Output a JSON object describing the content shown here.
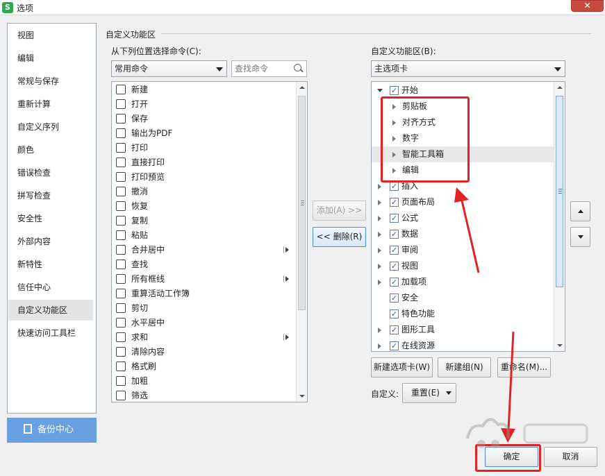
{
  "window": {
    "app_icon": "S",
    "title": "选项",
    "close_glyph": "✕"
  },
  "sidebar": {
    "items": [
      {
        "label": "视图"
      },
      {
        "label": "编辑"
      },
      {
        "label": "常规与保存"
      },
      {
        "label": "重新计算"
      },
      {
        "label": "自定义序列"
      },
      {
        "label": "颜色"
      },
      {
        "label": "错误检查"
      },
      {
        "label": "拼写检查"
      },
      {
        "label": "安全性"
      },
      {
        "label": "外部内容"
      },
      {
        "label": "新特性"
      },
      {
        "label": "信任中心"
      },
      {
        "label": "自定义功能区",
        "active": true
      },
      {
        "label": "快速访问工具栏"
      }
    ],
    "backup_label": "备份中心"
  },
  "main": {
    "group_title": "自定义功能区",
    "left": {
      "label": "从下列位置选择命令(C):",
      "source_value": "常用命令",
      "search_placeholder": "查找命令",
      "commands": [
        {
          "label": "新建",
          "icon": "new-doc-icon"
        },
        {
          "label": "打开",
          "icon": "folder-icon"
        },
        {
          "label": "保存",
          "icon": "save-icon"
        },
        {
          "label": "输出为PDF",
          "icon": "pdf-icon"
        },
        {
          "label": "打印",
          "icon": "printer-icon"
        },
        {
          "label": "直接打印",
          "icon": "print-direct-icon"
        },
        {
          "label": "打印预览",
          "icon": "print-preview-icon"
        },
        {
          "label": "撤消",
          "icon": "undo-icon"
        },
        {
          "label": "恢复",
          "icon": "redo-icon"
        },
        {
          "label": "复制",
          "icon": "copy-icon"
        },
        {
          "label": "粘贴",
          "icon": "paste-icon"
        },
        {
          "label": "合并居中",
          "icon": "merge-center-icon",
          "submenu": true
        },
        {
          "label": "查找",
          "icon": "find-icon"
        },
        {
          "label": "所有框线",
          "icon": "all-borders-icon",
          "submenu": true
        },
        {
          "label": "重算活动工作簿",
          "icon": "recalc-icon"
        },
        {
          "label": "剪切",
          "icon": "scissors-icon"
        },
        {
          "label": "水平居中",
          "icon": "align-center-icon"
        },
        {
          "label": "求和",
          "icon": "sum-icon",
          "submenu": true
        },
        {
          "label": "清除内容",
          "icon": "eraser-icon"
        },
        {
          "label": "格式刷",
          "icon": "format-painter-icon"
        },
        {
          "label": "加粗",
          "icon": "bold-icon"
        },
        {
          "label": "筛选",
          "icon": "filter-icon"
        }
      ]
    },
    "add_label": "添加(A) >>",
    "remove_label": "<< 删除(R)",
    "right": {
      "label": "自定义功能区(B):",
      "scope_value": "主选项卡",
      "tree": [
        {
          "label": "开始",
          "level": 0,
          "checked": true,
          "expanded": true
        },
        {
          "label": "剪贴板",
          "level": 1
        },
        {
          "label": "对齐方式",
          "level": 1
        },
        {
          "label": "数字",
          "level": 1
        },
        {
          "label": "智能工具箱",
          "level": 1,
          "highlight": true
        },
        {
          "label": "编辑",
          "level": 1
        },
        {
          "label": "插入",
          "level": 0,
          "checked": true
        },
        {
          "label": "页面布局",
          "level": 0,
          "checked": true
        },
        {
          "label": "公式",
          "level": 0,
          "checked": true
        },
        {
          "label": "数据",
          "level": 0,
          "checked": true
        },
        {
          "label": "审阅",
          "level": 0,
          "checked": true
        },
        {
          "label": "视图",
          "level": 0,
          "checked": true
        },
        {
          "label": "加载项",
          "level": 0,
          "checked": true
        },
        {
          "label": "安全",
          "level": 0,
          "checked": true,
          "no_expander": true
        },
        {
          "label": "特色功能",
          "level": 0,
          "checked": true,
          "no_expander": true
        },
        {
          "label": "图形工具",
          "level": 0,
          "checked": true
        },
        {
          "label": "在线资源",
          "level": 0,
          "checked": true
        }
      ],
      "new_tab_label": "新建选项卡(W)",
      "new_group_label": "新建组(N)",
      "rename_label": "重命名(M)...",
      "customize_label": "自定义:",
      "reset_label": "重置(E)"
    }
  },
  "footer": {
    "ok_label": "确定",
    "cancel_label": "取消"
  },
  "colors": {
    "accent": "#6a9fe0",
    "annotation": "#e02424",
    "close": "#c94a3f"
  }
}
